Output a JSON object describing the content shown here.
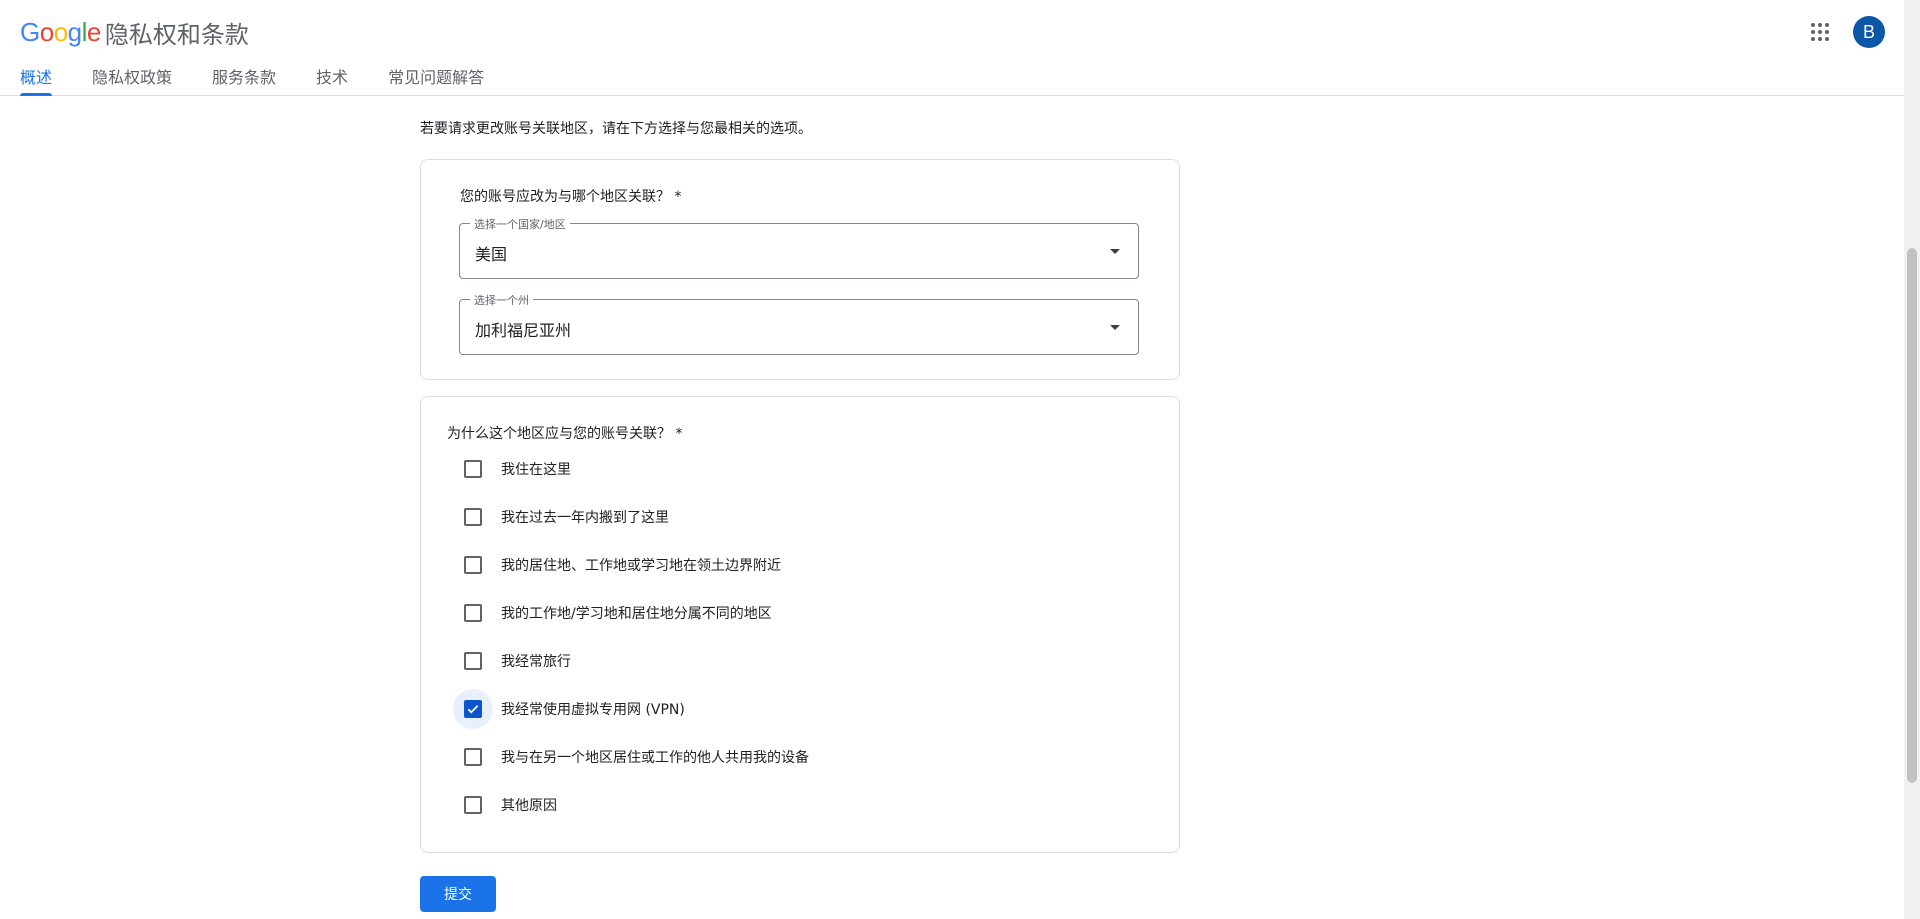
{
  "header": {
    "logo_letters": [
      {
        "char": "G",
        "color": "#4285F4"
      },
      {
        "char": "o",
        "color": "#EA4335"
      },
      {
        "char": "o",
        "color": "#FBBC05"
      },
      {
        "char": "g",
        "color": "#4285F4"
      },
      {
        "char": "l",
        "color": "#34A853"
      },
      {
        "char": "e",
        "color": "#EA4335"
      }
    ],
    "product_name": "隐私权和条款",
    "apps_icon": "grid-apps-icon",
    "avatar_initial": "B",
    "avatar_color": "#0b57a7"
  },
  "tabs": [
    {
      "label": "概述",
      "active": true
    },
    {
      "label": "隐私权政策",
      "active": false
    },
    {
      "label": "服务条款",
      "active": false
    },
    {
      "label": "技术",
      "active": false
    },
    {
      "label": "常见问题解答",
      "active": false
    }
  ],
  "main": {
    "intro": "若要请求更改账号关联地区，请在下方选择与您最相关的选项。",
    "region_card": {
      "question": "您的账号应改为与哪个地区关联？ *",
      "country_select": {
        "legend": "选择一个国家/地区",
        "value": "美国"
      },
      "state_select": {
        "legend": "选择一个州",
        "value": "加利福尼亚州"
      }
    },
    "reason_card": {
      "question": "为什么这个地区应与您的账号关联？ *",
      "options": [
        {
          "label": "我住在这里",
          "checked": false
        },
        {
          "label": "我在过去一年内搬到了这里",
          "checked": false
        },
        {
          "label": "我的居住地、工作地或学习地在领土边界附近",
          "checked": false
        },
        {
          "label": "我的工作地/学习地和居住地分属不同的地区",
          "checked": false
        },
        {
          "label": "我经常旅行",
          "checked": false
        },
        {
          "label": "我经常使用虚拟专用网 (VPN)",
          "checked": true
        },
        {
          "label": "我与在另一个地区居住或工作的他人共用我的设备",
          "checked": false
        },
        {
          "label": "其他原因",
          "checked": false
        }
      ]
    },
    "submit_label": "提交",
    "accent_color": "#1a73e8"
  }
}
